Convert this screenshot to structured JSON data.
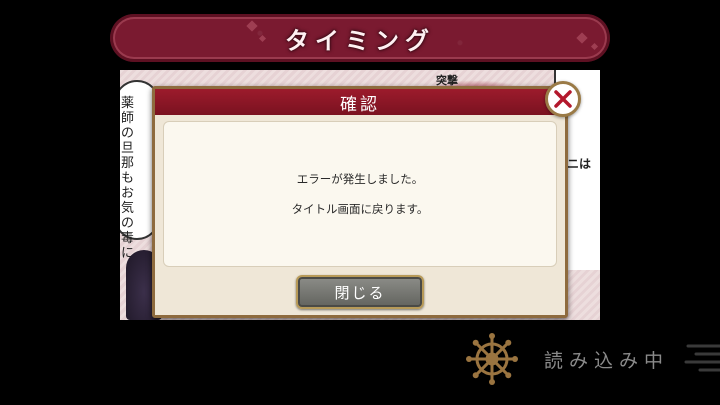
{
  "banner": {
    "title": "タイミング"
  },
  "comic": {
    "left_bubble_text": "薬師の旦那もお気の毒に……",
    "shout_text": "突撃",
    "right_fragment": "ニは"
  },
  "dialog": {
    "title": "確認",
    "message_lines": [
      "エラーが発生しました。",
      "タイトル画面に戻ります。"
    ],
    "close_button_label": "閉じる"
  },
  "loading": {
    "label": "読み込み中"
  },
  "colors": {
    "banner": "#7a1a30",
    "dialog_header": "#8c1626",
    "dialog_bg": "#efe7d7",
    "close_x": "#b3182c",
    "gold_border": "#b79a58"
  }
}
